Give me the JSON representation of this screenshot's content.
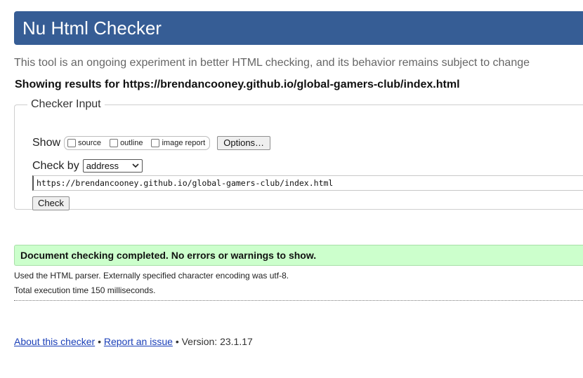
{
  "header": {
    "title": "Nu Html Checker"
  },
  "intro": "This tool is an ongoing experiment in better HTML checking, and its behavior remains subject to change",
  "showing_results": "Showing results for https://brendancooney.github.io/global-gamers-club/index.html",
  "checker_input": {
    "legend": "Checker Input",
    "show_label": "Show",
    "options": [
      {
        "label": "source",
        "checked": false
      },
      {
        "label": "outline",
        "checked": false
      },
      {
        "label": "image report",
        "checked": false
      }
    ],
    "options_button": "Options…",
    "check_by_label": "Check by",
    "check_by_value": "address",
    "url_value": "https://brendancooney.github.io/global-gamers-club/index.html",
    "check_button": "Check"
  },
  "result": {
    "success_message": "Document checking completed. No errors or warnings to show.",
    "parser_info": "Used the HTML parser. Externally specified character encoding was utf-8.",
    "execution_time": "Total execution time 150 milliseconds."
  },
  "footer": {
    "about_link": "About this checker",
    "separator": "•",
    "report_link": "Report an issue",
    "version": "Version: 23.1.17"
  },
  "colors": {
    "header_bg": "#365d95",
    "success_bg": "#ccffcc",
    "link": "#1a3fb8"
  }
}
